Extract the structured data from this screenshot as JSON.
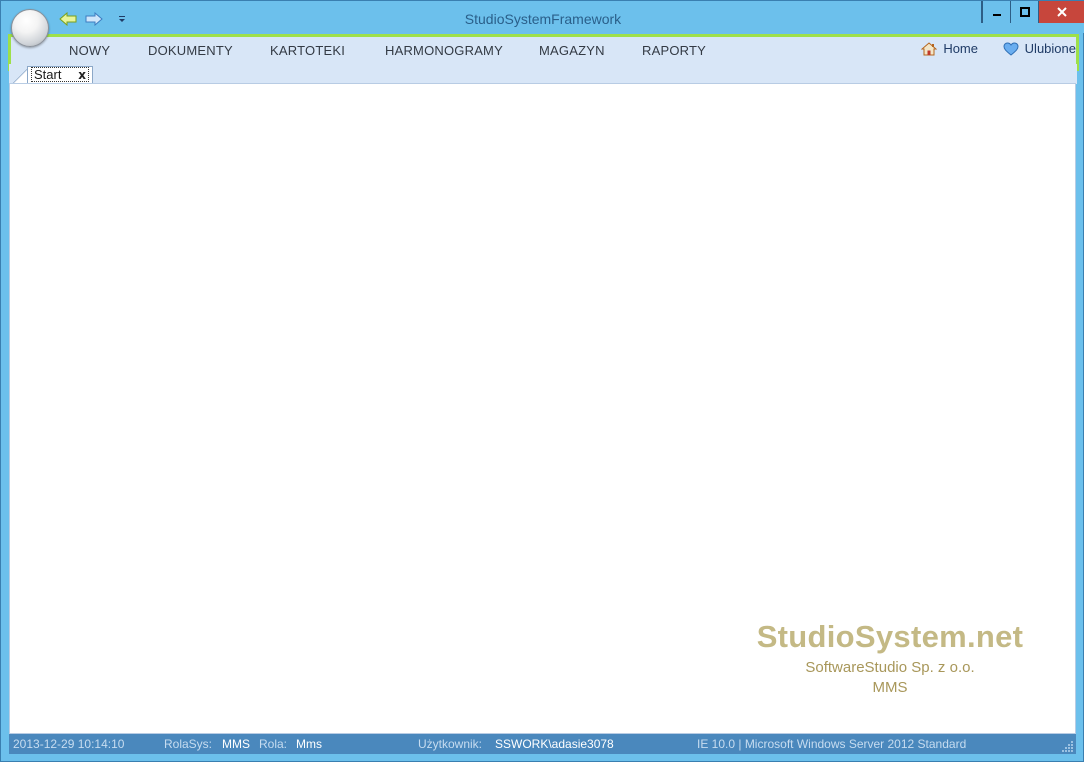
{
  "window": {
    "title": "StudioSystemFramework"
  },
  "menu": {
    "items": [
      {
        "label": "NOWY"
      },
      {
        "label": "DOKUMENTY"
      },
      {
        "label": "KARTOTEKI"
      },
      {
        "label": "HARMONOGRAMY"
      },
      {
        "label": "MAGAZYN"
      },
      {
        "label": "RAPORTY"
      }
    ],
    "home_label": "Home",
    "favorites_label": "Ulubione"
  },
  "tabs": [
    {
      "label": "Start",
      "close": "x"
    }
  ],
  "branding": {
    "name": "StudioSystem.net",
    "company": "SoftwareStudio Sp. z o.o.",
    "code": "MMS"
  },
  "status": {
    "datetime": "2013-12-29 10:14:10",
    "rolasys_label": "RolaSys:",
    "rolasys_value": "MMS",
    "rola_label": "Rola:",
    "rola_value": "Mms",
    "user_label": "Użytkownik:",
    "user_value": "SSWORK\\adasie3078",
    "system_info": "IE 10.0 | Microsoft Windows Server 2012 Standard"
  },
  "icons": {
    "back": "arrow-left-icon",
    "forward": "arrow-right-icon",
    "qat_dropdown": "chevron-down-icon",
    "minimize": "minimize-icon",
    "maximize": "maximize-icon",
    "close": "close-icon",
    "home": "home-icon",
    "favorites": "heart-icon",
    "resize": "resize-grip-icon"
  },
  "colors": {
    "title_bar": "#6cc0ec",
    "ribbon": "#d8e6f7",
    "highlight_border": "#9ee04a",
    "close_button": "#c7463c",
    "status_bar": "#4a88bd",
    "brand_text": "#c4b985"
  }
}
